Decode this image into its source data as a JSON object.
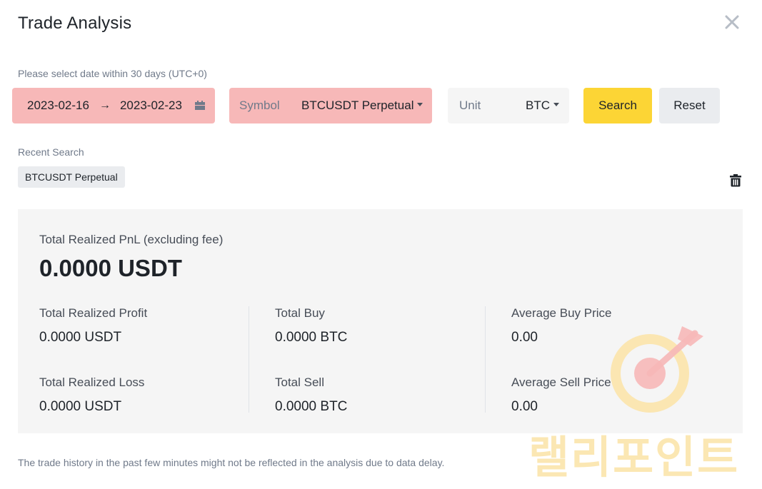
{
  "header": {
    "title": "Trade Analysis",
    "close_icon": "close-icon"
  },
  "filters": {
    "hint": "Please select date within 30 days (UTC+0)",
    "date_start": "2023-02-16",
    "date_arrow": "→",
    "date_end": "2023-02-23",
    "calendar_icon": "calendar-icon",
    "symbol_label": "Symbol",
    "symbol_value": "BTCUSDT Perpetual",
    "unit_label": "Unit",
    "unit_value": "BTC",
    "search_label": "Search",
    "reset_label": "Reset"
  },
  "recent": {
    "label": "Recent Search",
    "chips": [
      "BTCUSDT Perpetual"
    ],
    "clear_icon": "trash-icon"
  },
  "summary": {
    "total_label": "Total Realized PnL (excluding fee)",
    "total_value": "0.0000 USDT",
    "stats": [
      {
        "label": "Total Realized Profit",
        "value": "0.0000 USDT"
      },
      {
        "label": "Total Realized Loss",
        "value": "0.0000 USDT"
      },
      {
        "label": "Total Buy",
        "value": "0.0000 BTC"
      },
      {
        "label": "Total Sell",
        "value": "0.0000 BTC"
      },
      {
        "label": "Average Buy Price",
        "value": "0.00"
      },
      {
        "label": "Average Sell Price",
        "value": "0.00"
      }
    ]
  },
  "footer": {
    "note": "The trade history in the past few minutes might not be reflected in the analysis due to data delay."
  },
  "watermark": {
    "text": "랠리포인트",
    "icon": "target-arrow-icon"
  },
  "colors": {
    "accent": "#fcd535",
    "highlight": "#f7b8b8",
    "panel": "#f5f5f5"
  }
}
